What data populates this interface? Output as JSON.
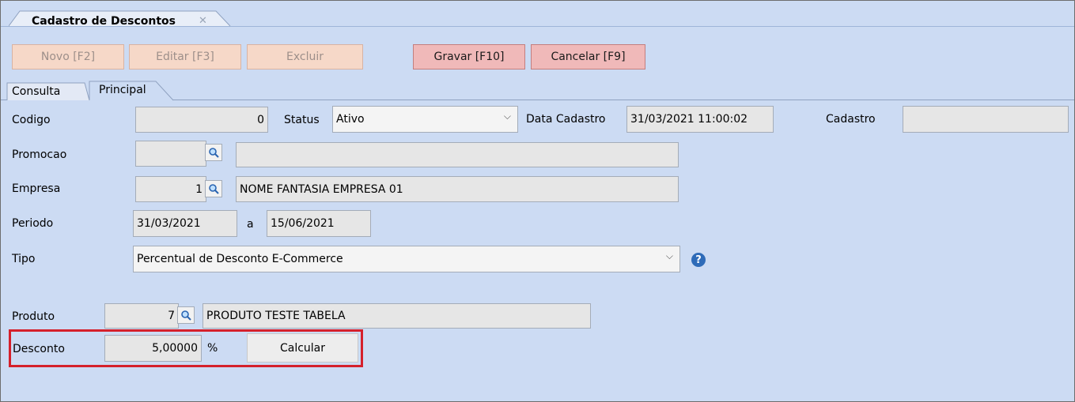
{
  "window": {
    "doc_tab_title": "Cadastro de Descontos",
    "doc_tab_close": "✕"
  },
  "toolbar": {
    "novo": "Novo [F2]",
    "editar": "Editar [F3]",
    "excluir": "Excluir",
    "gravar": "Gravar [F10]",
    "cancelar": "Cancelar [F9]"
  },
  "subtabs": [
    "Consulta",
    "Principal"
  ],
  "form": {
    "codigo_label": "Codigo",
    "codigo_value": "0",
    "status_label": "Status",
    "status_value": "Ativo",
    "data_cadastro_label": "Data Cadastro",
    "data_cadastro_value": "31/03/2021 11:00:02",
    "cadastro_label": "Cadastro",
    "cadastro_value": "",
    "promocao_label": "Promocao",
    "promocao_code": "",
    "promocao_name": "",
    "empresa_label": "Empresa",
    "empresa_code": "1",
    "empresa_name": "NOME FANTASIA EMPRESA 01",
    "periodo_label": "Periodo",
    "periodo_start": "31/03/2021",
    "periodo_sep": "a",
    "periodo_end": "15/06/2021",
    "tipo_label": "Tipo",
    "tipo_value": "Percentual de Desconto E-Commerce",
    "produto_label": "Produto",
    "produto_code": "7",
    "produto_name": "PRODUTO TESTE TABELA",
    "desconto_label": "Desconto",
    "desconto_value": "5,00000",
    "desconto_unit": "%",
    "calcular": "Calcular"
  },
  "icons": {
    "help": "?",
    "combo_arrow": "⌵"
  }
}
